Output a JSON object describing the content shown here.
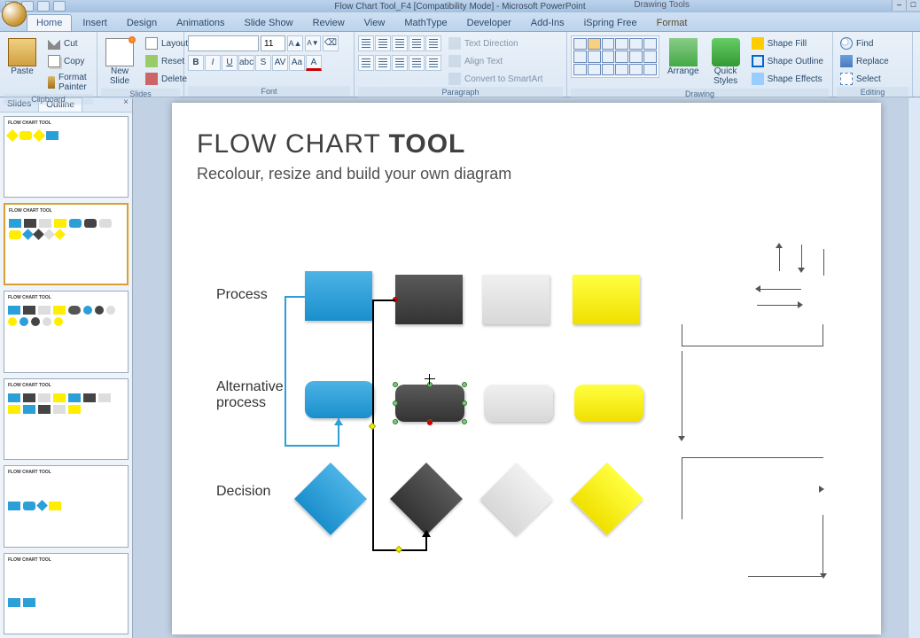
{
  "app": {
    "title": "Flow Chart Tool_F4 [Compatibility Mode] - Microsoft PowerPoint",
    "contextual_tab": "Drawing Tools"
  },
  "tabs": [
    "Home",
    "Insert",
    "Design",
    "Animations",
    "Slide Show",
    "Review",
    "View",
    "MathType",
    "Developer",
    "Add-Ins",
    "iSpring Free",
    "Format"
  ],
  "ribbon": {
    "clipboard": {
      "label": "Clipboard",
      "paste": "Paste",
      "cut": "Cut",
      "copy": "Copy",
      "format_painter": "Format Painter"
    },
    "slides": {
      "label": "Slides",
      "new_slide": "New\nSlide",
      "layout": "Layout",
      "reset": "Reset",
      "delete": "Delete"
    },
    "font": {
      "label": "Font",
      "size": "11"
    },
    "paragraph": {
      "label": "Paragraph",
      "text_direction": "Text Direction",
      "align_text": "Align Text",
      "convert": "Convert to SmartArt"
    },
    "drawing": {
      "label": "Drawing",
      "arrange": "Arrange",
      "quick_styles": "Quick\nStyles",
      "shape_fill": "Shape Fill",
      "shape_outline": "Shape Outline",
      "shape_effects": "Shape Effects"
    },
    "editing": {
      "label": "Editing",
      "find": "Find",
      "replace": "Replace",
      "select": "Select"
    }
  },
  "slidepanel": {
    "slides_tab": "Slides",
    "outline_tab": "Outline"
  },
  "slide": {
    "title_pre": "FLOW CHART ",
    "title_bold": "TOOL",
    "subtitle": "Recolour, resize and build your own diagram",
    "row1": "Process",
    "row2": "Alternative process",
    "row3": "Decision"
  },
  "colors": {
    "blue": "#2a9fd8",
    "dark": "#404040",
    "grey": "#e0e0e0",
    "yellow": "#fff000"
  }
}
